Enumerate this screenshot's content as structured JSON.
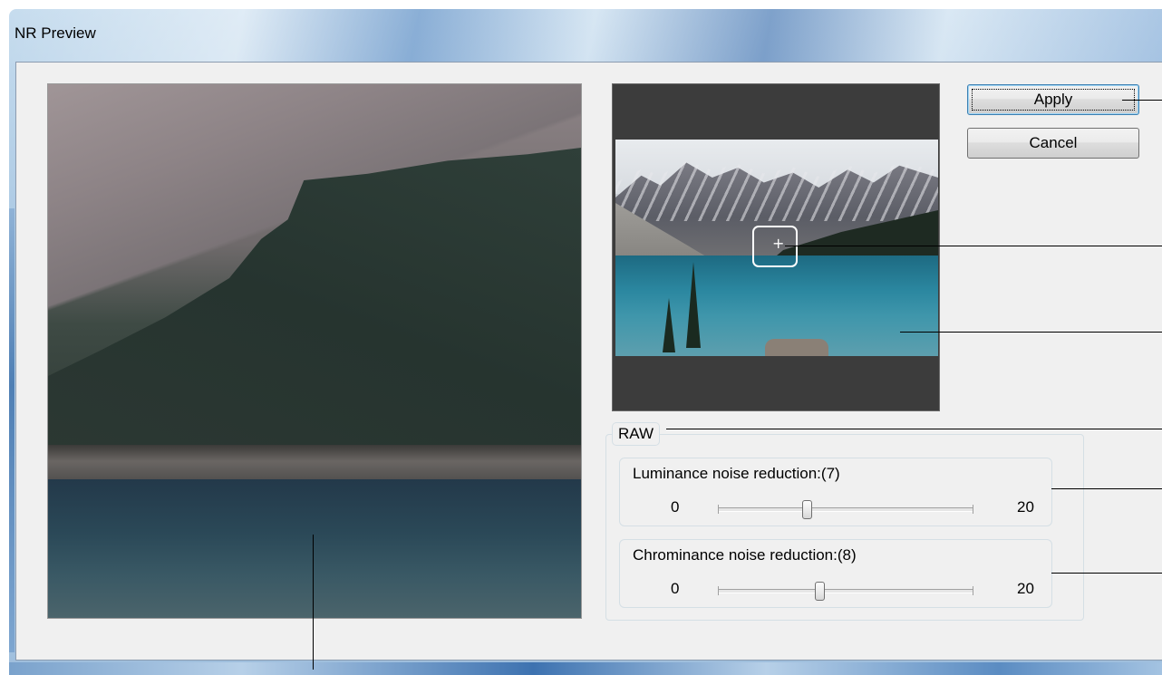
{
  "window": {
    "title": "NR Preview"
  },
  "buttons": {
    "apply": "Apply",
    "cancel": "Cancel"
  },
  "raw_group": {
    "title": "RAW",
    "luminance": {
      "label": "Luminance noise reduction:(7)",
      "min": "0",
      "max": "20",
      "value": 7
    },
    "chrominance": {
      "label": "Chrominance noise reduction:(8)",
      "min": "0",
      "max": "20",
      "value": 8
    }
  },
  "navigator": {
    "crosshair": "+"
  }
}
